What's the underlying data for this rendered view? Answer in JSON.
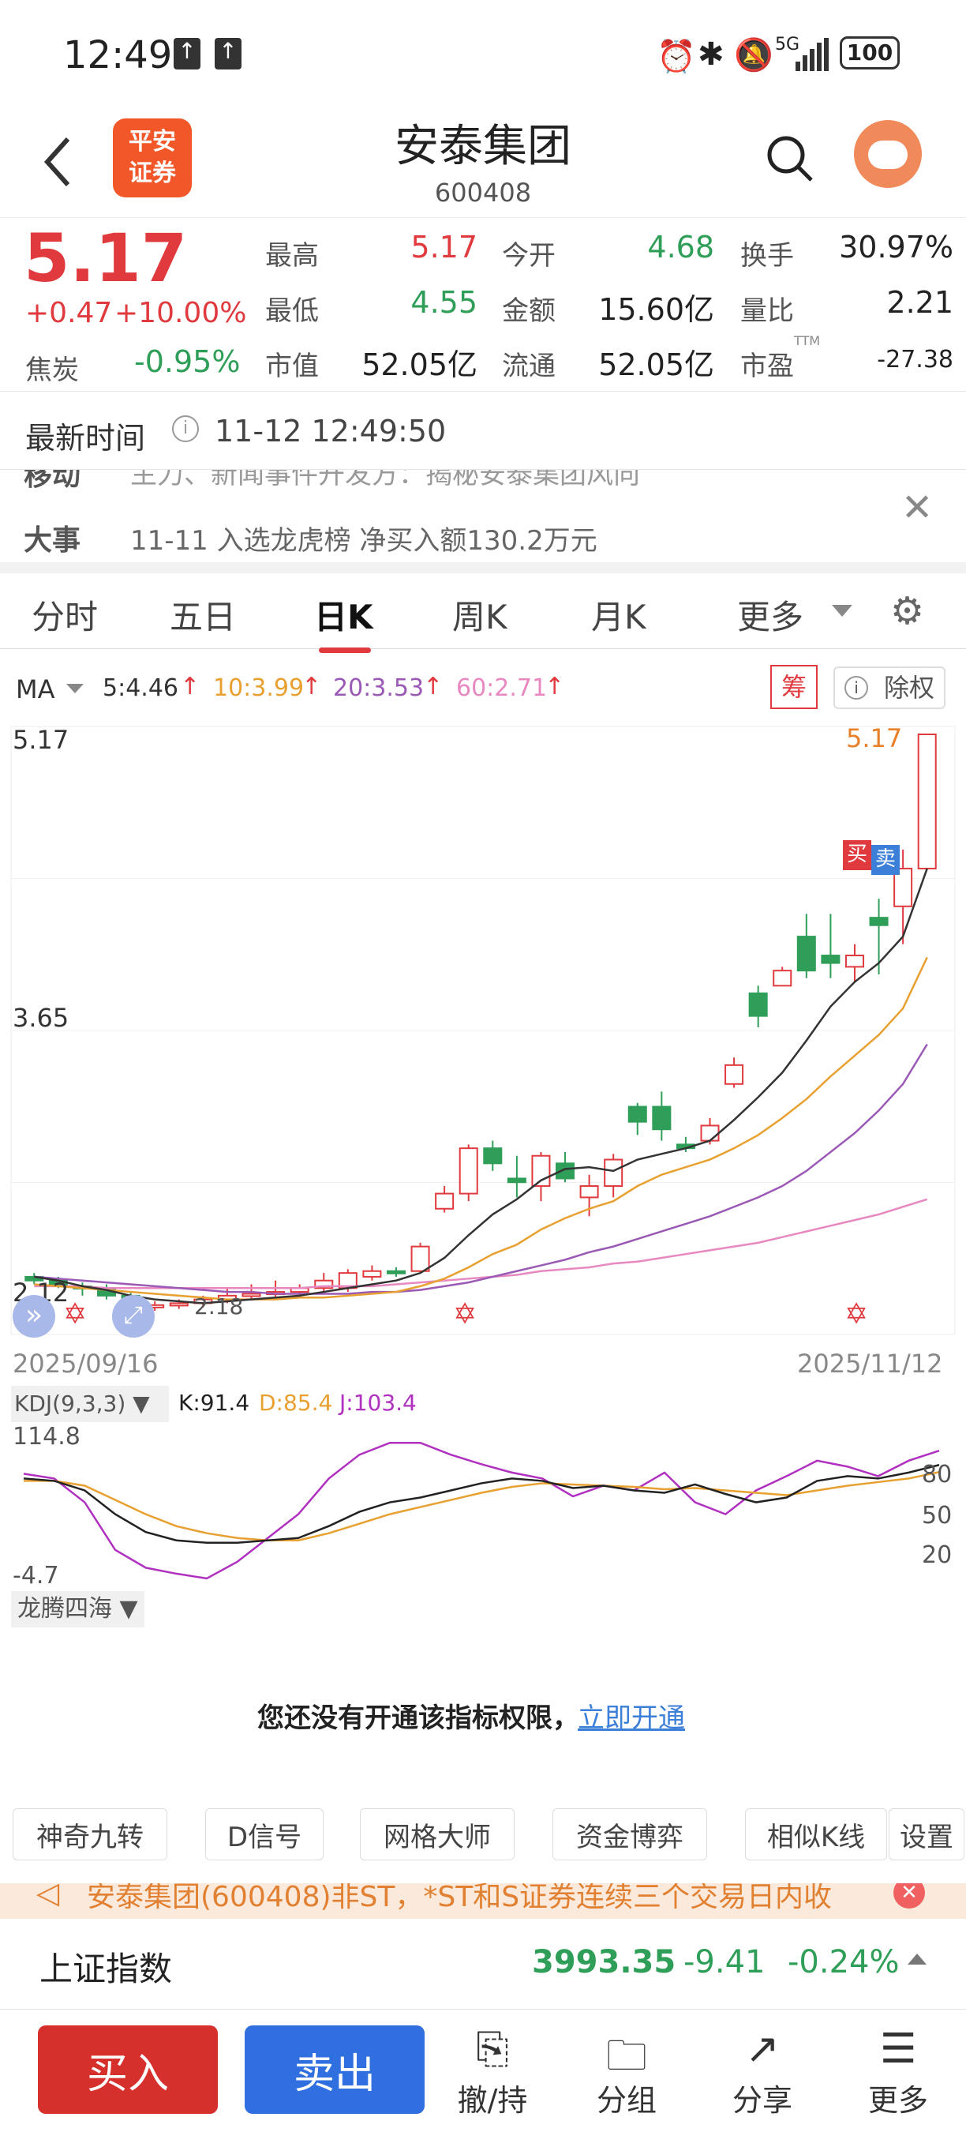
{
  "status": {
    "time": "12:49",
    "battery": "100",
    "net": "5G"
  },
  "stock": {
    "name": "安泰集团",
    "code": "600408",
    "price": "5.17",
    "change": "+0.47",
    "pct": "+10.00%",
    "sector": "焦炭",
    "sector_pct": "-0.95%"
  },
  "quote": {
    "high_l": "最高",
    "high": "5.17",
    "open_l": "今开",
    "open": "4.68",
    "turn_l": "换手",
    "turn": "30.97%",
    "low_l": "最低",
    "low": "4.55",
    "amt_l": "金额",
    "amt": "15.60亿",
    "vr_l": "量比",
    "vr": "2.21",
    "mcap_l": "市值",
    "mcap": "52.05亿",
    "float_l": "流通",
    "float": "52.05亿",
    "pe_l": "市盈",
    "pe_sup": "TTM",
    "pe": "-27.38"
  },
  "time_row": {
    "label": "最新时间",
    "value": "11-12 12:49:50"
  },
  "news": {
    "tag1": "移动",
    "text1": "主力、新闻事件开发方：揭秘安泰集团风向",
    "tag2": "大事",
    "text2": "11-11 入选龙虎榜 净买入额130.2万元"
  },
  "tabs": [
    "分时",
    "五日",
    "日K",
    "周K",
    "月K",
    "更多"
  ],
  "chart": {
    "ma_label": "MA",
    "ma5": "5:4.46",
    "ma10": "10:3.99",
    "ma20": "20:3.53",
    "ma60": "60:2.71",
    "chou": "筹",
    "chuquan": "除权",
    "y_top": "5.17",
    "y_mid": "3.65",
    "y_bot": "2.12",
    "low_mark": "2.18",
    "top_mark": "5.17",
    "d_start": "2025/09/16",
    "d_end": "2025/11/12",
    "buy": "买",
    "sell": "卖",
    "colors": {
      "up": "#e03a3e",
      "down": "#2f9e58",
      "ma5": "#333333",
      "ma10": "#e8a030",
      "ma20": "#9b59b6",
      "ma60": "#e888c0"
    }
  },
  "kdj": {
    "label": "KDJ(9,3,3)",
    "k": "K:91.4",
    "d": "D:85.4",
    "j": "J:103.4",
    "ymax": "114.8",
    "ymin": "-4.7",
    "l80": "80",
    "l50": "50",
    "l20": "20"
  },
  "ind": {
    "label": "龙腾四海",
    "msg": "您还没有开通该指标权限，",
    "link": "立即开通"
  },
  "tools": [
    "神奇九转",
    "D信号",
    "网格大师",
    "资金博弈",
    "相似K线",
    "设置"
  ],
  "notice": "安泰集团(600408)非ST，*ST和S证券连续三个交易日内收",
  "index": {
    "name": "上证指数",
    "value": "3993.35",
    "chg": "-9.41",
    "pct": "-0.24%"
  },
  "bottom": {
    "buy": "买入",
    "sell": "卖出",
    "i1": "撤/持",
    "i2": "分组",
    "i3": "分享",
    "i4": "更多"
  },
  "logo": {
    "l1": "平安",
    "l2": "证券"
  },
  "chart_data": {
    "type": "candlestick",
    "candles": [
      [
        2.3,
        2.28,
        2.32,
        2.26
      ],
      [
        2.28,
        2.25,
        2.3,
        2.24
      ],
      [
        2.25,
        2.24,
        2.27,
        2.2
      ],
      [
        2.24,
        2.2,
        2.26,
        2.18
      ],
      [
        2.2,
        2.14,
        2.22,
        2.12
      ],
      [
        2.14,
        2.15,
        2.17,
        2.12
      ],
      [
        2.15,
        2.16,
        2.18,
        2.13
      ],
      [
        2.16,
        2.18,
        2.2,
        2.14
      ],
      [
        2.18,
        2.2,
        2.24,
        2.16
      ],
      [
        2.2,
        2.21,
        2.26,
        2.18
      ],
      [
        2.21,
        2.22,
        2.28,
        2.19
      ],
      [
        2.22,
        2.24,
        2.26,
        2.2
      ],
      [
        2.24,
        2.28,
        2.32,
        2.22
      ],
      [
        2.24,
        2.32,
        2.34,
        2.22
      ],
      [
        2.3,
        2.33,
        2.36,
        2.28
      ],
      [
        2.33,
        2.32,
        2.35,
        2.3
      ],
      [
        2.33,
        2.46,
        2.48,
        2.32
      ],
      [
        2.66,
        2.74,
        2.78,
        2.64
      ],
      [
        2.74,
        2.98,
        3.0,
        2.7
      ],
      [
        2.98,
        2.9,
        3.02,
        2.86
      ],
      [
        2.82,
        2.8,
        2.94,
        2.72
      ],
      [
        2.78,
        2.94,
        2.96,
        2.7
      ],
      [
        2.9,
        2.82,
        2.96,
        2.8
      ],
      [
        2.72,
        2.78,
        2.84,
        2.62
      ],
      [
        2.78,
        2.92,
        2.95,
        2.72
      ],
      [
        3.2,
        3.12,
        3.22,
        3.05
      ],
      [
        3.2,
        3.08,
        3.28,
        3.02
      ],
      [
        3.0,
        2.98,
        3.04,
        2.96
      ],
      [
        3.02,
        3.1,
        3.14,
        3.0
      ],
      [
        3.32,
        3.42,
        3.46,
        3.3
      ],
      [
        3.8,
        3.68,
        3.84,
        3.62
      ],
      [
        3.84,
        3.92,
        3.94,
        3.84
      ],
      [
        4.1,
        3.92,
        4.22,
        3.88
      ],
      [
        4.0,
        3.96,
        4.22,
        3.88
      ],
      [
        3.94,
        4.0,
        4.06,
        3.86
      ],
      [
        4.2,
        4.16,
        4.3,
        3.9
      ],
      [
        4.26,
        4.46,
        4.56,
        4.06
      ],
      [
        4.46,
        5.17,
        5.17,
        4.55
      ]
    ],
    "ma5": [
      2.3,
      2.28,
      2.25,
      2.23,
      2.2,
      2.18,
      2.17,
      2.16,
      2.17,
      2.18,
      2.19,
      2.2,
      2.22,
      2.24,
      2.26,
      2.28,
      2.32,
      2.4,
      2.52,
      2.63,
      2.71,
      2.81,
      2.87,
      2.88,
      2.86,
      2.92,
      2.95,
      2.98,
      3.02,
      3.13,
      3.25,
      3.38,
      3.55,
      3.73,
      3.86,
      3.96,
      4.1,
      4.46
    ],
    "ma10": [
      2.26,
      2.25,
      2.24,
      2.23,
      2.22,
      2.21,
      2.2,
      2.19,
      2.18,
      2.18,
      2.18,
      2.19,
      2.19,
      2.2,
      2.21,
      2.22,
      2.25,
      2.29,
      2.35,
      2.42,
      2.47,
      2.55,
      2.61,
      2.66,
      2.7,
      2.78,
      2.84,
      2.88,
      2.92,
      2.98,
      3.05,
      3.14,
      3.24,
      3.36,
      3.47,
      3.58,
      3.72,
      3.99
    ],
    "ma20": [
      2.3,
      2.29,
      2.28,
      2.27,
      2.26,
      2.25,
      2.24,
      2.23,
      2.22,
      2.22,
      2.21,
      2.21,
      2.21,
      2.21,
      2.22,
      2.22,
      2.23,
      2.25,
      2.27,
      2.3,
      2.33,
      2.36,
      2.39,
      2.43,
      2.46,
      2.5,
      2.54,
      2.58,
      2.62,
      2.67,
      2.72,
      2.78,
      2.86,
      2.96,
      3.06,
      3.18,
      3.32,
      3.53
    ],
    "ma60": [
      2.25,
      2.25,
      2.25,
      2.24,
      2.24,
      2.24,
      2.24,
      2.24,
      2.24,
      2.24,
      2.24,
      2.24,
      2.25,
      2.25,
      2.25,
      2.26,
      2.27,
      2.28,
      2.29,
      2.3,
      2.31,
      2.33,
      2.34,
      2.35,
      2.37,
      2.38,
      2.4,
      2.42,
      2.44,
      2.46,
      2.48,
      2.51,
      2.54,
      2.57,
      2.6,
      2.63,
      2.67,
      2.71
    ],
    "kdj_k": [
      80,
      78,
      70,
      50,
      35,
      28,
      26,
      26,
      28,
      30,
      40,
      52,
      60,
      64,
      70,
      76,
      80,
      78,
      72,
      74,
      70,
      68,
      75,
      67,
      60,
      64,
      78,
      82,
      80,
      85,
      91.4
    ],
    "kdj_d": [
      78,
      78,
      74,
      62,
      50,
      40,
      34,
      30,
      28,
      28,
      34,
      42,
      50,
      56,
      62,
      68,
      73,
      76,
      75,
      74,
      73,
      71,
      72,
      70,
      68,
      66,
      70,
      74,
      77,
      80,
      85.4
    ],
    "kdj_j": [
      84,
      80,
      60,
      20,
      5,
      0,
      -4,
      10,
      30,
      50,
      80,
      100,
      110,
      110,
      100,
      92,
      85,
      80,
      65,
      74,
      70,
      85,
      60,
      50,
      70,
      82,
      95,
      90,
      82,
      95,
      103.4
    ]
  }
}
